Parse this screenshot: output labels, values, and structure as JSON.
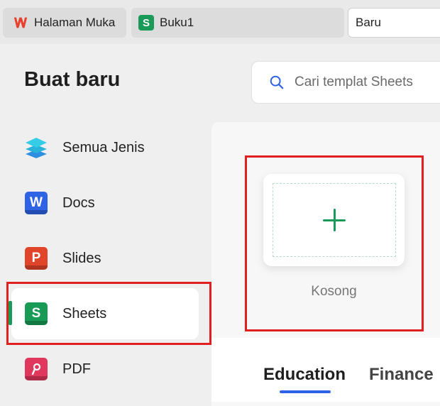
{
  "tabs": [
    {
      "label": "Halaman Muka",
      "icon": "wps-logo-icon"
    },
    {
      "label": "Buku1",
      "icon": "sheets-icon"
    },
    {
      "label": "Baru",
      "icon": ""
    }
  ],
  "page_title": "Buat baru",
  "search": {
    "placeholder": "Cari templat Sheets"
  },
  "sidebar": {
    "items": [
      {
        "label": "Semua Jenis",
        "icon": "layers-icon",
        "active": false
      },
      {
        "label": "Docs",
        "icon": "docs-icon",
        "letter": "W",
        "active": false
      },
      {
        "label": "Slides",
        "icon": "slides-icon",
        "letter": "P",
        "active": false
      },
      {
        "label": "Sheets",
        "icon": "sheets-icon",
        "letter": "S",
        "active": true
      },
      {
        "label": "PDF",
        "icon": "pdf-icon",
        "letter": "",
        "active": false
      }
    ]
  },
  "blank_template": {
    "label": "Kosong"
  },
  "categories": [
    "Education",
    "Finance"
  ],
  "colors": {
    "accent_green": "#1a9a57",
    "highlight_red": "#e02020",
    "underline_blue": "#2f63e5"
  }
}
